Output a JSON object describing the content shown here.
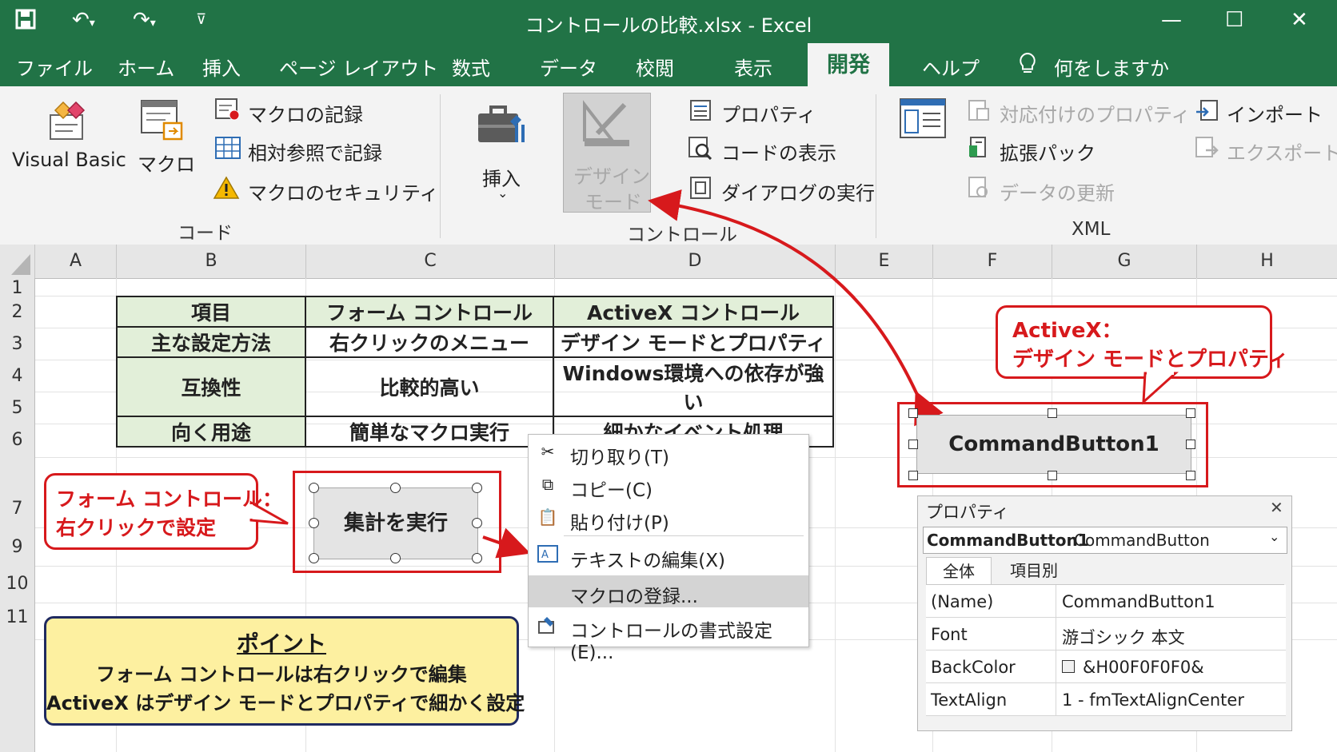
{
  "window": {
    "title": "コントロールの比較.xlsx  -  Excel"
  },
  "tabs": [
    "ファイル",
    "ホーム",
    "挿入",
    "ページ レイアウト",
    "数式",
    "データ",
    "校閲",
    "表示",
    "開発",
    "ヘルプ"
  ],
  "active_tab": "開発",
  "tell_me": "何をしますか",
  "ribbon": {
    "code": {
      "visual_basic": "Visual Basic",
      "macro": "マクロ",
      "record": "マクロの記録",
      "relative": "相対参照で記録",
      "security": "マクロのセキュリティ",
      "group": "コード"
    },
    "controls": {
      "insert": "挿入",
      "design_mode_1": "デザイン",
      "design_mode_2": "モード",
      "properties": "プロパティ",
      "view_code": "コードの表示",
      "run_dialog": "ダイアログの実行",
      "group": "コントロール"
    },
    "xml": {
      "map_props": "対応付けのプロパティ",
      "expansion": "拡張パック",
      "refresh": "データの更新",
      "import": "インポート",
      "export": "エクスポート",
      "group": "XML"
    }
  },
  "columns": [
    "A",
    "B",
    "C",
    "D",
    "E",
    "F",
    "G",
    "H"
  ],
  "rows": [
    "1",
    "2",
    "3",
    "4",
    "5",
    "6",
    "7",
    "9",
    "10",
    "11"
  ],
  "comparison_table": {
    "header": [
      "項目",
      "フォーム コントロール",
      "ActiveX コントロール"
    ],
    "rows": [
      [
        "主な設定方法",
        "右クリックのメニュー",
        "デザイン モードとプロパティ"
      ],
      [
        "互換性",
        "比較的高い",
        "Windows環境への依存が強い"
      ],
      [
        "向く用途",
        "簡単なマクロ実行",
        "細かなイベント処理"
      ]
    ]
  },
  "form_callout": {
    "line1": "フォーム コントロール：",
    "line2": "右クリックで設定"
  },
  "form_button": "集計を実行",
  "context_menu": [
    {
      "label": "切り取り(T)",
      "icon": "scissors-icon"
    },
    {
      "label": "コピー(C)",
      "icon": "copy-icon"
    },
    {
      "label": "貼り付け(P)",
      "icon": "paste-icon"
    },
    {
      "label": "テキストの編集(X)",
      "icon": "edit-text-icon"
    },
    {
      "label": "マクロの登録...",
      "icon": ""
    },
    {
      "label": "コントロールの書式設定(E)...",
      "icon": "format-control-icon"
    }
  ],
  "activex_callout": {
    "line1": "ActiveX：",
    "line2": "デザイン モードとプロパティ"
  },
  "activex_button": "CommandButton1",
  "properties": {
    "title": "プロパティ",
    "object": "CommandButton1",
    "object_type": "CommandButton",
    "tabs": [
      "全体",
      "項目別"
    ],
    "rows": [
      {
        "name": "(Name)",
        "value": "CommandButton1"
      },
      {
        "name": "Font",
        "value": "游ゴシック 本文"
      },
      {
        "name": "BackColor",
        "value": "&H00F0F0F0&"
      },
      {
        "name": "TextAlign",
        "value": "1 - fmTextAlignCenter"
      }
    ]
  },
  "point": {
    "title": "ポイント",
    "line1": "フォーム コントロールは右クリックで編集",
    "line2": "ActiveX はデザイン モードとプロパティで細かく設定"
  },
  "colors": {
    "excel_green": "#217346",
    "callout_red": "#d7191c",
    "header_green": "#e2efd9",
    "point_yellow": "#fdf0a0"
  }
}
